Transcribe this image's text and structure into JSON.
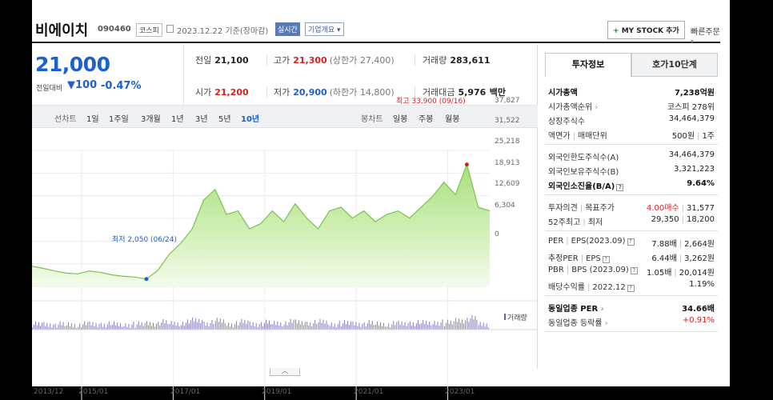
{
  "header": {
    "company_name": "비에이치",
    "code": "090460",
    "market_badge": "코스피",
    "date_text": "2023.12.22 기준(장마감)",
    "realtime_badge": "실시간",
    "company_info_label": "기업개요",
    "my_stock_plus": "+",
    "my_stock_label": "MY STOCK 추가",
    "quick_order_label": "빠른주문"
  },
  "price": {
    "current": "21,000",
    "change_label": "전일대비",
    "change_value": "100",
    "change_pct": "-0.47%"
  },
  "stats": {
    "prev_close_label": "전일",
    "prev_close": "21,100",
    "high_label": "고가",
    "high": "21,300",
    "upper_limit": "(상한가 27,400)",
    "volume_label": "거래량",
    "volume": "283,611",
    "open_label": "시가",
    "open": "21,200",
    "low_label": "저가",
    "low": "20,900",
    "lower_limit": "(하한가 14,800)",
    "amount_label": "거래대금",
    "amount": "5,976",
    "amount_unit": "백만"
  },
  "toolbar": {
    "line_chart_label": "선차트",
    "periods": [
      "1일",
      "1주일",
      "3개월",
      "1년",
      "3년",
      "5년",
      "10년"
    ],
    "active_period": "10년",
    "candle_label": "봉차트",
    "candles": [
      "일봉",
      "주봉",
      "월봉"
    ]
  },
  "chart_data": {
    "type": "area",
    "y_ticks": [
      "37,827",
      "31,522",
      "25,218",
      "18,913",
      "12,609",
      "6,304",
      "0"
    ],
    "ylim": [
      0,
      37827
    ],
    "x_ticks": [
      "2013/12",
      "2015/01",
      "2017/01",
      "2019/01",
      "2021/01",
      "2023/01"
    ],
    "xlim": [
      "2013-12",
      "2023-12"
    ],
    "series": [
      {
        "x": [
          "2013-12",
          "2014-03",
          "2014-06",
          "2014-09",
          "2014-12",
          "2015-03",
          "2015-06",
          "2015-09",
          "2015-12",
          "2016-03",
          "2016-06",
          "2016-09",
          "2016-12",
          "2017-03",
          "2017-06",
          "2017-09",
          "2017-12",
          "2018-03",
          "2018-06",
          "2018-09",
          "2018-12",
          "2019-03",
          "2019-06",
          "2019-09",
          "2019-12",
          "2020-03",
          "2020-06",
          "2020-09",
          "2020-12",
          "2021-03",
          "2021-06",
          "2021-09",
          "2021-12",
          "2022-03",
          "2022-06",
          "2022-09",
          "2022-12",
          "2023-03",
          "2023-06",
          "2023-09",
          "2023-12"
        ],
        "y": [
          5600,
          5000,
          4300,
          3700,
          3500,
          4300,
          3900,
          3200,
          2800,
          2600,
          2050,
          4500,
          9000,
          12000,
          16000,
          24000,
          27000,
          20000,
          21000,
          16000,
          17500,
          21000,
          18000,
          23000,
          19000,
          16000,
          21000,
          22000,
          19000,
          21000,
          18000,
          20000,
          21000,
          19000,
          22000,
          25000,
          29000,
          25500,
          33900,
          22000,
          21000
        ]
      }
    ],
    "annotations": {
      "high_text": "최고 33,900 (09/16)",
      "low_text": "최저 2,050 (06/24)"
    },
    "volume_label": "거래량",
    "grid": true
  },
  "invest_info": {
    "tab_active": "투자정보",
    "tab_other": "호가10단계",
    "rows1": [
      {
        "k": "시가총액",
        "v": "7,238억원",
        "bold": true
      },
      {
        "k": "시가총액순위",
        "v": "코스피 278위",
        "arrow": true
      },
      {
        "k": "상장주식수",
        "v": "34,464,379"
      },
      {
        "k": "액면가",
        "k2": "매매단위",
        "v": "500원",
        "v2": "1주"
      }
    ],
    "rows2": [
      {
        "k": "외국인한도주식수(A)",
        "v": "34,464,379"
      },
      {
        "k": "외국인보유주식수(B)",
        "v": "3,321,223"
      },
      {
        "k": "외국인소진율(B/A)",
        "v": "9.64%",
        "bold": true,
        "info": true
      }
    ],
    "rows3": [
      {
        "k": "투자의견",
        "k2": "목표주가",
        "v": "4.00매수",
        "v2": "31,577",
        "red": true
      },
      {
        "k": "52주최고",
        "k2": "최저",
        "v": "29,350",
        "v2": "18,200"
      }
    ],
    "rows4": [
      {
        "k": "PER",
        "k2": "EPS(2023.09)",
        "v": "7.88배",
        "v2": "2,664원",
        "info": true
      },
      {
        "k": "추정PER",
        "k2": "EPS",
        "v": "6.44배",
        "v2": "3,262원",
        "info": true
      },
      {
        "k": "PBR",
        "k2": "BPS (2023.09)",
        "v": "1.05배",
        "v2": "20,014원",
        "info": true
      },
      {
        "k": "배당수익률",
        "k2": "2022.12",
        "v": "1.19%",
        "info": true
      }
    ],
    "rows5": [
      {
        "k": "동일업종 PER",
        "v": "34.66배",
        "bold": true,
        "arrow": true
      },
      {
        "k": "동일업종 등락률",
        "v": "+0.91%",
        "red": true,
        "arrow": true
      }
    ]
  },
  "colors": {
    "up": "#d62020",
    "down": "#1b5fd0",
    "area_fill": "#a8e07a",
    "area_line": "#7ac24a",
    "volume": "#6a5ab0"
  }
}
